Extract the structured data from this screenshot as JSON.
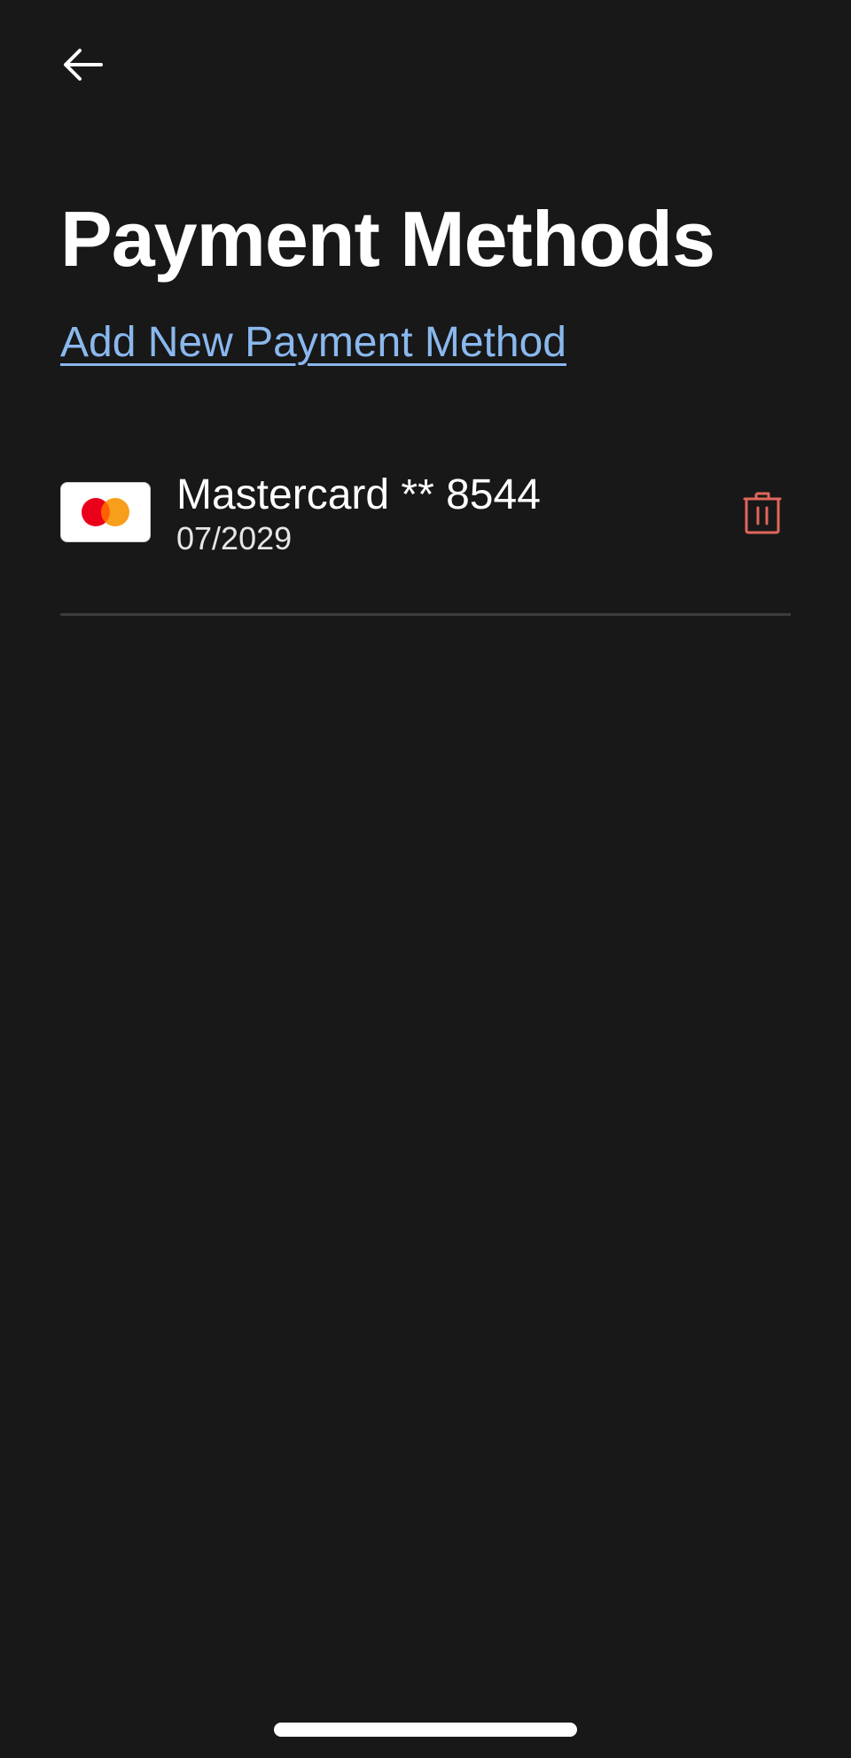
{
  "header": {
    "back_icon": "arrow-left-icon",
    "title": "Payment Methods"
  },
  "actions": {
    "add_payment_label": "Add New Payment Method",
    "link_color": "#8ab8ee"
  },
  "payment_methods": [
    {
      "brand_icon": "mastercard-icon",
      "name": "Mastercard ** 8544",
      "expiry": "07/2029",
      "delete_icon": "trash-icon",
      "delete_color": "#e0665c"
    }
  ],
  "theme": {
    "background": "#181818",
    "text": "#ffffff",
    "divider": "#3c3c3c"
  }
}
